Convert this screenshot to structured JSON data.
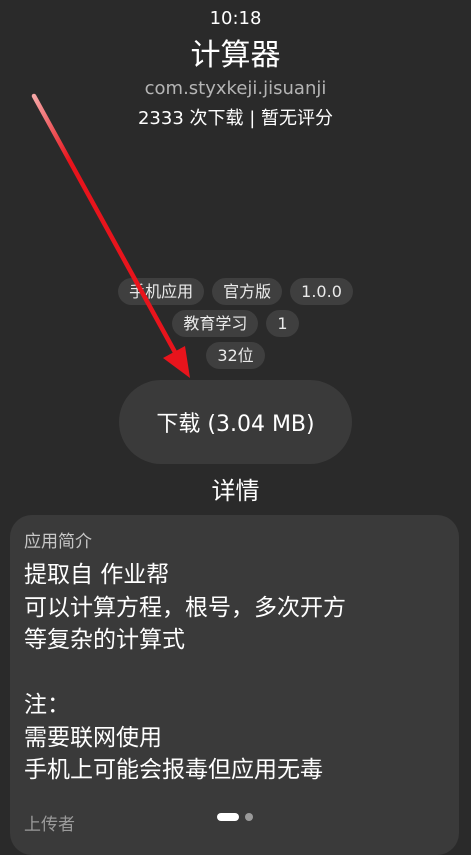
{
  "status_bar": {
    "time": "10:18"
  },
  "app": {
    "name": "计算器",
    "package": "com.styxkeji.jisuanji",
    "stats": "2333 次下载 | 暂无评分"
  },
  "tags": [
    [
      "手机应用",
      "官方版",
      "1.0.0"
    ],
    [
      "教育学习",
      "1"
    ],
    [
      "32位"
    ]
  ],
  "download_button": "下载 (3.04 MB)",
  "details_link": "详情",
  "intro_card": {
    "title": "应用简介",
    "description": "提取自 作业帮\n可以计算方程，根号，多次开方\n等复杂的计算式\n\n注：\n需要联网使用\n手机上可能会报毒但应用无毒",
    "uploader_label": "上传者"
  },
  "pager": {
    "active_index": 0,
    "count": 2
  },
  "annotation": {
    "arrow_color": "#e8141c"
  }
}
